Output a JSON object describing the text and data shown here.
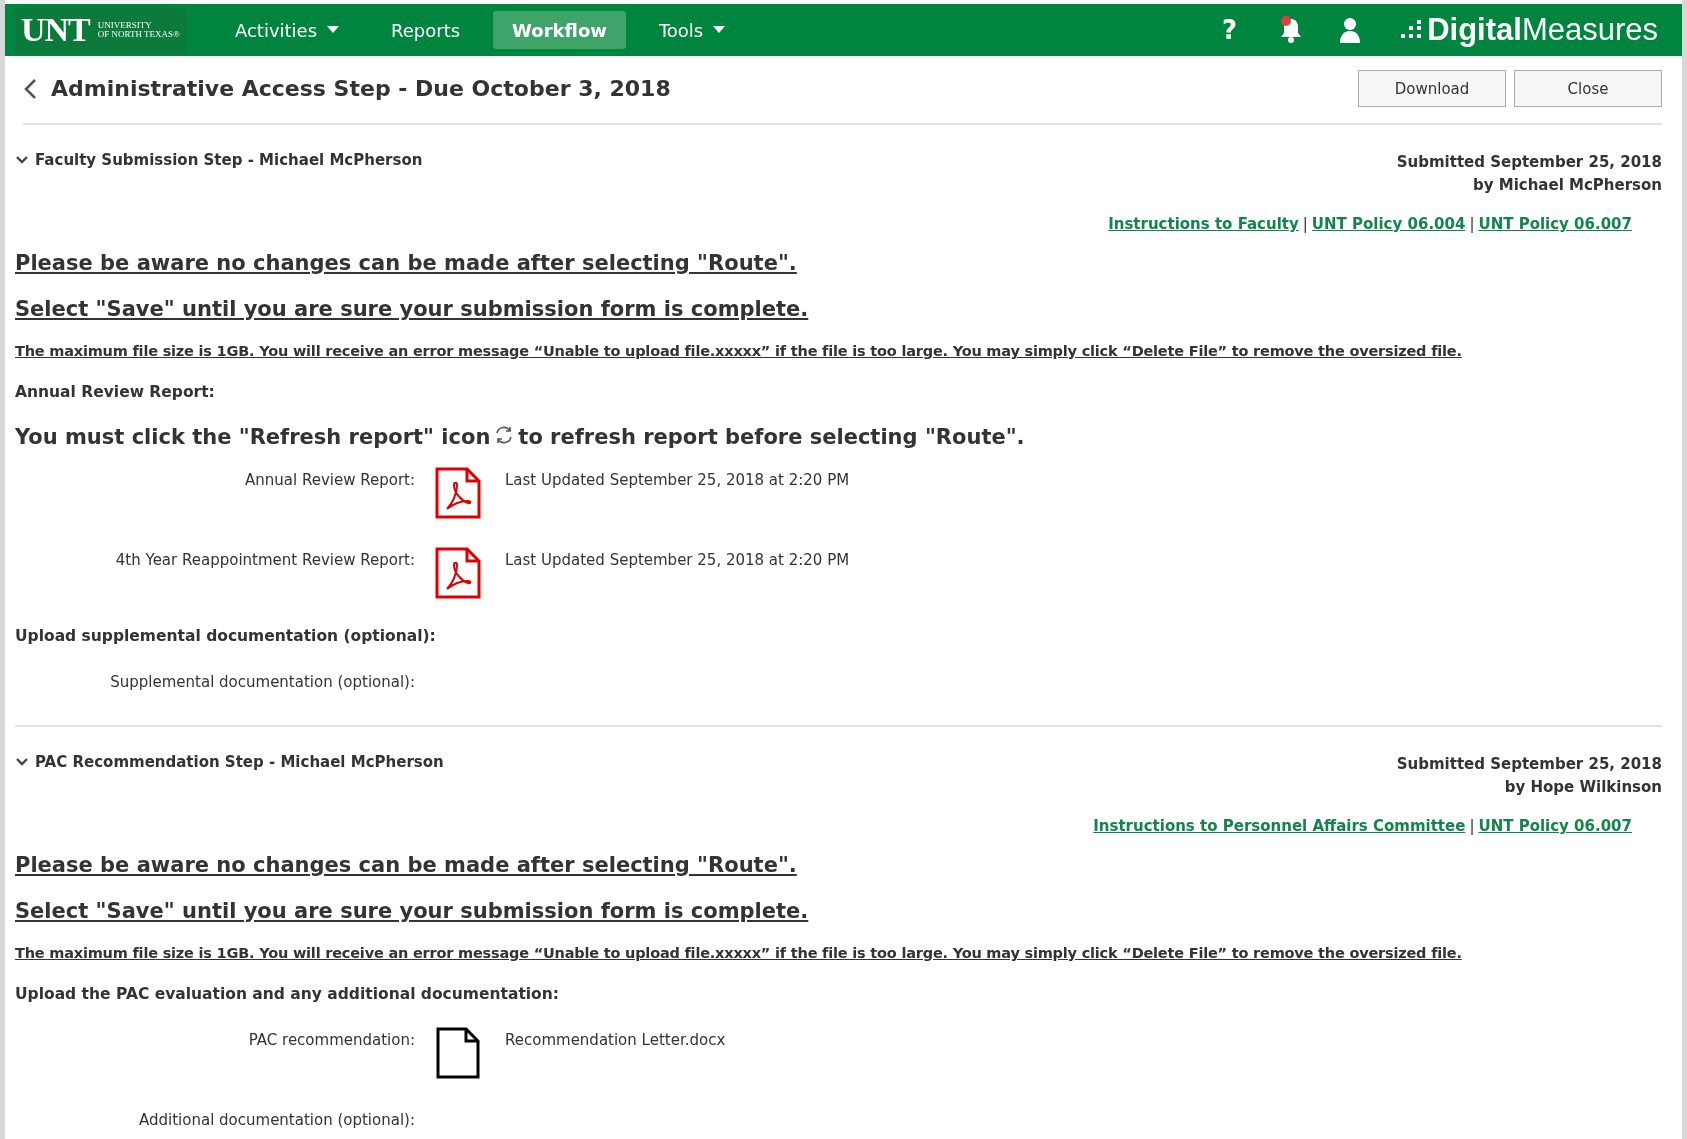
{
  "nav": {
    "logo": {
      "mark": "UNT",
      "line1": "UNIVERSITY",
      "line2": "OF NORTH TEXAS®"
    },
    "items": [
      {
        "label": "Activities",
        "selected": false,
        "has_menu": true
      },
      {
        "label": "Reports",
        "selected": false,
        "has_menu": false
      },
      {
        "label": "Workflow",
        "selected": true,
        "has_menu": false
      },
      {
        "label": "Tools",
        "selected": false,
        "has_menu": true
      }
    ],
    "help": "?",
    "notifications": {
      "unread": true
    },
    "brand": {
      "bold": "Digital",
      "light": "Measures"
    }
  },
  "page": {
    "title": "Administrative Access Step - Due October 3, 2018",
    "buttons": [
      "Download",
      "Close"
    ]
  },
  "sections": [
    {
      "title": "Faculty Submission Step - Michael McPherson",
      "expanded": true,
      "submitted": "Submitted September 25, 2018",
      "submitted_by": "by Michael McPherson",
      "separator": "|",
      "links": [
        "Instructions to Faculty",
        "UNT Policy 06.004",
        "UNT Policy 06.007"
      ],
      "blocks": [
        {
          "kind": "notice",
          "text": "Please be aware no changes can be made after selecting \"Route\". "
        },
        {
          "kind": "notice",
          "text": "Select \"Save\" until you are sure your submission form is complete. "
        },
        {
          "kind": "fine",
          "text": "The maximum file size is 1GB.  You will receive an error message “Unable to upload file.xxxxx” if the file is too large. You may simply click “Delete File” to remove the oversized file."
        },
        {
          "kind": "heading",
          "text": "Annual Review Report:"
        },
        {
          "kind": "refresh",
          "before": "You must click  the \"Refresh report\" icon",
          "after": "to refresh report before selecting \"Route\"."
        },
        {
          "kind": "pdf_file",
          "label": "Annual Review Report:",
          "file": "Last Updated September 25, 2018 at 2:20 PM"
        },
        {
          "kind": "pdf_file",
          "label": "4th Year Reappointment Review Report:",
          "file": "Last Updated September 25, 2018 at 2:20 PM"
        },
        {
          "kind": "heading",
          "text": "Upload supplemental documentation (optional):"
        },
        {
          "kind": "field",
          "label": "Supplemental documentation (optional):"
        }
      ]
    },
    {
      "title": "PAC Recommendation Step - Michael McPherson",
      "expanded": true,
      "submitted": "Submitted September 25, 2018",
      "submitted_by": "by Hope Wilkinson",
      "separator": "|",
      "links": [
        "Instructions to Personnel Affairs Committee",
        "UNT Policy 06.007"
      ],
      "blocks": [
        {
          "kind": "notice",
          "text": "Please be aware no changes can be made after selecting \"Route\". "
        },
        {
          "kind": "notice",
          "text": "Select \"Save\" until you are sure your submission form is complete. "
        },
        {
          "kind": "fine",
          "text": "The maximum file size is 1GB.  You will receive an error message “Unable to upload file.xxxxx” if the file is too large. You may simply click “Delete File” to remove the oversized file. "
        },
        {
          "kind": "heading",
          "text": "Upload the PAC evaluation and any additional documentation:"
        },
        {
          "kind": "doc_file",
          "label": "PAC recommendation:",
          "file": "Recommendation Letter.docx"
        },
        {
          "kind": "field",
          "label": "Additional documentation (optional):"
        }
      ]
    }
  ]
}
